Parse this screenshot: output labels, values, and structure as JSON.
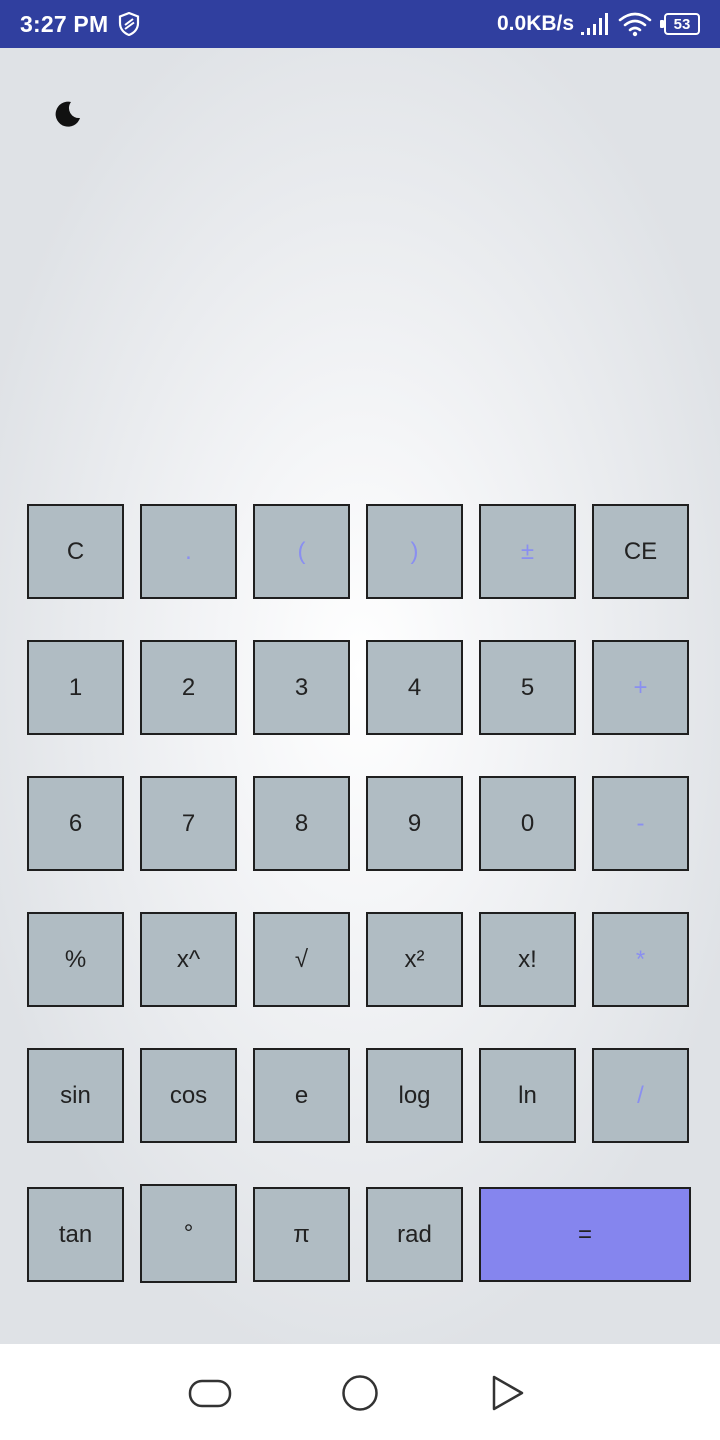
{
  "status_bar": {
    "time": "3:27 PM",
    "network_speed": "0.0KB/s",
    "battery_level": "53",
    "icons": [
      "shield-icon",
      "signal-icon",
      "wifi-icon",
      "battery-icon"
    ]
  },
  "app": {
    "theme_toggle_icon": "moon-icon",
    "colors": {
      "button_bg": "#b0bcc3",
      "equals_bg": "#8585ee",
      "accent_text": "#8a8ff0",
      "status_bar_bg": "#303f9f"
    }
  },
  "keypad": {
    "rows": [
      [
        {
          "label": "C"
        },
        {
          "label": "."
        },
        {
          "label": "("
        },
        {
          "label": ")"
        },
        {
          "label": "±"
        },
        {
          "label": "CE"
        }
      ],
      [
        {
          "label": "1"
        },
        {
          "label": "2"
        },
        {
          "label": "3"
        },
        {
          "label": "4"
        },
        {
          "label": "5"
        },
        {
          "label": "+"
        }
      ],
      [
        {
          "label": "6"
        },
        {
          "label": "7"
        },
        {
          "label": "8"
        },
        {
          "label": "9"
        },
        {
          "label": "0"
        },
        {
          "label": "-"
        }
      ],
      [
        {
          "label": "%"
        },
        {
          "label": "x^"
        },
        {
          "label": "√"
        },
        {
          "label": "x²"
        },
        {
          "label": "x!"
        },
        {
          "label": "*"
        }
      ],
      [
        {
          "label": "sin"
        },
        {
          "label": "cos"
        },
        {
          "label": "e"
        },
        {
          "label": "log"
        },
        {
          "label": "ln"
        },
        {
          "label": "/"
        }
      ],
      [
        {
          "label": "tan"
        },
        {
          "label": "°"
        },
        {
          "label": "π"
        },
        {
          "label": "rad"
        },
        {
          "label": "="
        }
      ]
    ]
  },
  "nav_bar": {
    "icons": [
      "recents-icon",
      "home-icon",
      "back-icon"
    ]
  }
}
